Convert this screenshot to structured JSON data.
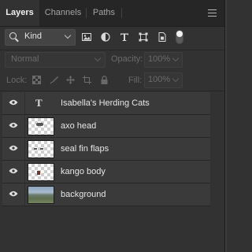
{
  "tabs": [
    {
      "label": "Layers",
      "active": true
    },
    {
      "label": "Channels",
      "active": false
    },
    {
      "label": "Paths",
      "active": false
    }
  ],
  "filter": {
    "kind_label": "Kind",
    "icons": [
      "pixel-layer-filter-icon",
      "adjustment-layer-filter-icon",
      "type-layer-filter-icon",
      "shape-layer-filter-icon",
      "smart-object-filter-icon",
      "filter-toggle-icon"
    ]
  },
  "blend": {
    "mode": "Normal",
    "opacity_label": "Opacity:",
    "opacity_value": "100%"
  },
  "lock": {
    "label": "Lock:",
    "icons": [
      "lock-transparent-pixels-icon",
      "lock-image-pixels-icon",
      "lock-position-icon",
      "lock-artboard-icon",
      "lock-all-icon"
    ],
    "fill_label": "Fill:",
    "fill_value": "100%"
  },
  "layers": [
    {
      "name": "Isabella's Herding Cats",
      "type": "text",
      "visible": true
    },
    {
      "name": "axo head",
      "type": "pixel",
      "visible": true
    },
    {
      "name": "seal fin flaps",
      "type": "pixel",
      "visible": true
    },
    {
      "name": "kango body",
      "type": "pixel",
      "visible": true
    },
    {
      "name": "background",
      "type": "pixel",
      "visible": true
    }
  ],
  "colors": {
    "panel_bg": "#323232",
    "tab_bar_bg": "#262626",
    "layer_row_bg": "#3a3a3a",
    "text_primary": "#e6e6e6",
    "text_disabled": "#6a6a6a"
  }
}
